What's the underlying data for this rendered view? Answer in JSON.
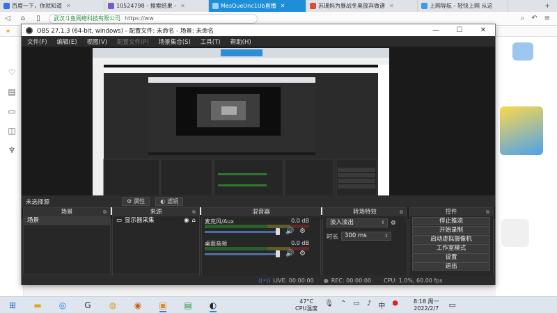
{
  "browser": {
    "tabs": [
      {
        "label": "百度一下，你就知道",
        "color": "#3b6ee8"
      },
      {
        "label": "10524798 - 搜索结果 - ",
        "color": "#7a58c9"
      },
      {
        "label": "MesQueUnc1Ub直播 ",
        "color": "#2a8fd6",
        "active": true
      },
      {
        "label": "苏珊妈为暴战冬奥放弃做谱",
        "color": "#e04a3a"
      },
      {
        "label": "上网导航 - 轻快上网 从这",
        "color": "#3b9ae8"
      }
    ],
    "address": {
      "site": "武汉斗鱼网络科技有限公司",
      "url": "https://ww"
    }
  },
  "obs": {
    "title": "OBS 27.1.3 (64-bit, windows) - 配置文件: 未命名 - 场景: 未命名",
    "menu": [
      "文件(F)",
      "编辑(E)",
      "视图(V)",
      "配置文件(P)",
      "场景集合(S)",
      "工具(T)",
      "帮助(H)"
    ],
    "source_bar": {
      "no_source": "未选择源",
      "properties": "属性",
      "filters": "滤镜"
    },
    "scenes": {
      "title": "场景",
      "items": [
        "场景"
      ]
    },
    "sources": {
      "title": "来源",
      "items": [
        "显示器采集"
      ]
    },
    "mixer": {
      "title": "混音器",
      "channels": [
        {
          "name": "麦克风/Aux",
          "db": "0.0 dB"
        },
        {
          "name": "桌面音频",
          "db": "0.0 dB"
        }
      ]
    },
    "transitions": {
      "title": "转场特效",
      "selected": "淡入淡出",
      "duration_label": "时长",
      "duration_value": "300 ms"
    },
    "controls": {
      "title": "控件",
      "buttons": [
        "停止推流",
        "开始录制",
        "启动虚拟摄像机",
        "工作室模式",
        "设置",
        "退出"
      ]
    },
    "status": {
      "live": "LIVE: 00:00:00",
      "rec": "REC: 00:00:00",
      "cpu": "CPU: 1.0%, 60.00 fps"
    }
  },
  "taskbar": {
    "weather_temp": "47°C",
    "weather_label": "CPU温度",
    "time": "8:18 周一",
    "date": "2022/2/7"
  }
}
